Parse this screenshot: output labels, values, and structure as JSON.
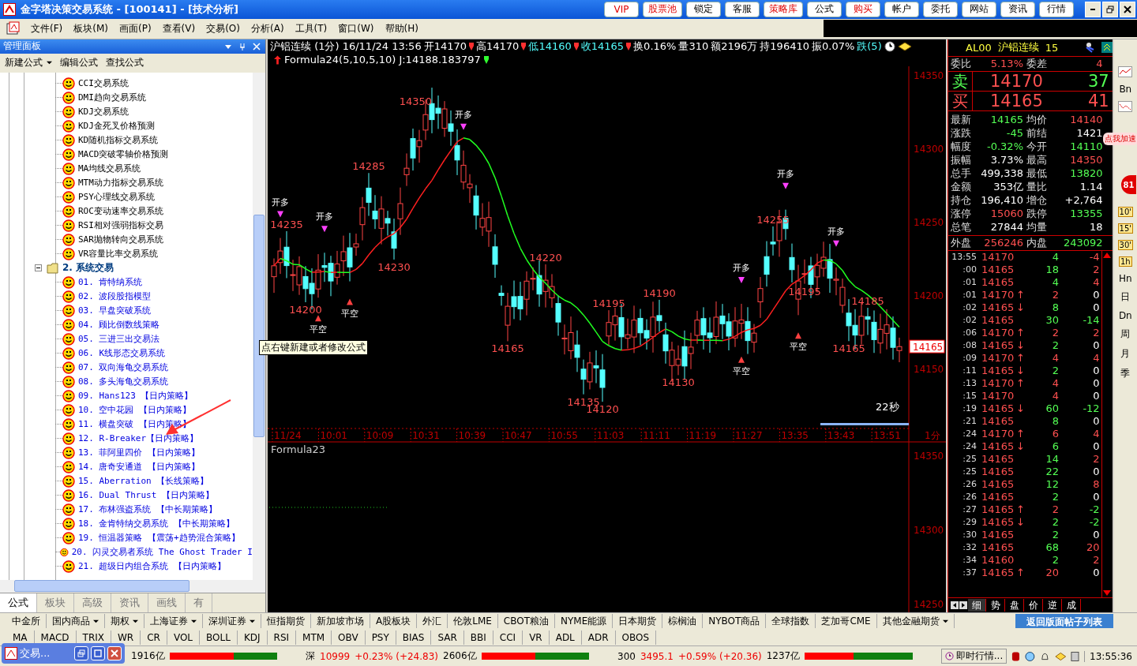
{
  "window": {
    "title": "金字塔决策交易系统 - [100141] - [技术分析]"
  },
  "title_buttons": [
    {
      "label": "VIP",
      "highlighted": true
    },
    {
      "label": "股票池",
      "highlighted": true
    },
    {
      "label": "锁定",
      "highlighted": false
    },
    {
      "label": "客服",
      "highlighted": false
    },
    {
      "label": "策略库",
      "highlighted": true
    },
    {
      "label": "公式",
      "highlighted": false
    },
    {
      "label": "购买",
      "highlighted": true
    },
    {
      "label": "帐户",
      "highlighted": false
    },
    {
      "label": "委托",
      "highlighted": false
    },
    {
      "label": "网站",
      "highlighted": false
    },
    {
      "label": "资讯",
      "highlighted": false
    },
    {
      "label": "行情",
      "highlighted": false
    }
  ],
  "menu": [
    "文件(F)",
    "板块(M)",
    "画面(P)",
    "查看(V)",
    "交易(O)",
    "分析(A)",
    "工具(T)",
    "窗口(W)",
    "帮助(H)"
  ],
  "panel": {
    "title": "管理面板",
    "toolbar": [
      {
        "label": "新建公式",
        "dropdown": true
      },
      {
        "label": "编辑公式",
        "dropdown": false
      },
      {
        "label": "查找公式",
        "dropdown": false
      }
    ],
    "tree": [
      {
        "label": "CCI交易系统",
        "kind": "indicator"
      },
      {
        "label": "DMI趋向交易系统",
        "kind": "indicator"
      },
      {
        "label": "KDJ交易系统",
        "kind": "indicator"
      },
      {
        "label": "KDJ金死叉价格预测",
        "kind": "indicator"
      },
      {
        "label": "KD随机指标交易系统",
        "kind": "indicator"
      },
      {
        "label": "MACD突破零轴价格预测",
        "kind": "indicator"
      },
      {
        "label": "MA均线交易系统",
        "kind": "indicator"
      },
      {
        "label": "MTM动力指标交易系统",
        "kind": "indicator"
      },
      {
        "label": "PSY心理线交易系统",
        "kind": "indicator"
      },
      {
        "label": "ROC变动速率交易系统",
        "kind": "indicator"
      },
      {
        "label": "RSI相对强弱指标交易",
        "kind": "indicator"
      },
      {
        "label": "SAR抛物转向交易系统",
        "kind": "indicator"
      },
      {
        "label": "VR容量比率交易系统",
        "kind": "indicator"
      },
      {
        "label": "2. 系统交易",
        "kind": "folder",
        "expanded": true,
        "children": [
          {
            "label": "01. 肯特纳系统",
            "kind": "strategy"
          },
          {
            "label": "02. 波段股指模型",
            "kind": "strategy"
          },
          {
            "label": "03. 早盘突破系统",
            "kind": "strategy"
          },
          {
            "label": "04. 顾比倒数线策略",
            "kind": "strategy"
          },
          {
            "label": "05. 三进三出交易法",
            "kind": "strategy"
          },
          {
            "label": "06. K线形态交易系统",
            "kind": "strategy"
          },
          {
            "label": "07. 双向海龟交易系统",
            "kind": "strategy"
          },
          {
            "label": "08. 多头海龟交易系统",
            "kind": "strategy"
          },
          {
            "label": "09. Hans123 【日内策略】",
            "kind": "strategy"
          },
          {
            "label": "10. 空中花园 【日内策略】",
            "kind": "strategy"
          },
          {
            "label": "11. 横盘突破 【日内策略】",
            "kind": "strategy"
          },
          {
            "label": "12. R-Breaker【日内策略】",
            "kind": "strategy"
          },
          {
            "label": "13. 菲阿里四价 【日内策略】",
            "kind": "strategy"
          },
          {
            "label": "14. 唐奇安通道 【日内策略】",
            "kind": "strategy"
          },
          {
            "label": "15. Aberration 【长线策略】",
            "kind": "strategy"
          },
          {
            "label": "16. Dual Thrust 【日内策略】",
            "kind": "strategy"
          },
          {
            "label": "17. 布林强盗系统 【中长期策略】",
            "kind": "strategy"
          },
          {
            "label": "18. 金肯特纳交易系统 【中长期策略】",
            "kind": "strategy"
          },
          {
            "label": "19. 恒温器策略 【震荡+趋势混合策略】",
            "kind": "strategy"
          },
          {
            "label": "20. 闪灵交易者系统 The Ghost Trader I",
            "kind": "strategy"
          },
          {
            "label": "21. 超级日内组合系统 【日内策略】",
            "kind": "strategy"
          }
        ]
      }
    ],
    "tabs": [
      {
        "label": "公式",
        "selected": true
      },
      {
        "label": "板块",
        "selected": false
      },
      {
        "label": "高级",
        "selected": false
      },
      {
        "label": "资讯",
        "selected": false
      },
      {
        "label": "画线",
        "selected": false
      },
      {
        "label": "有",
        "selected": false
      }
    ],
    "tooltip": "点右键新建或者修改公式"
  },
  "chart": {
    "symbol": "沪铝连续 (1分) 16/11/24 13:56",
    "header_items": [
      {
        "text": "开14170",
        "color": "#ffffff",
        "marker": true
      },
      {
        "text": "高14170",
        "color": "#ffffff",
        "marker": true
      },
      {
        "text": "低14160",
        "color": "#54ffff",
        "marker": true
      },
      {
        "text": "收14165",
        "color": "#54ffff",
        "marker": true
      },
      {
        "text": "换0.16%",
        "color": "#ffffff",
        "marker": false
      },
      {
        "text": "量310",
        "color": "#ffffff",
        "marker": false
      },
      {
        "text": "额2196万",
        "color": "#ffffff",
        "marker": false
      },
      {
        "text": "持196410",
        "color": "#ffffff",
        "marker": false
      },
      {
        "text": "振0.07%",
        "color": "#ffffff",
        "marker": false
      },
      {
        "text": "跌(5)",
        "color": "#54ffff",
        "marker": false
      }
    ],
    "formula": "Formula24(5,10,5,10) J:14188.183797",
    "price_ticks": [
      "14350",
      "14300",
      "14250",
      "14200",
      "14150"
    ],
    "current_price": "14165",
    "time_labels": [
      "11/24",
      "10:01",
      "10:09",
      "10:31",
      "10:39",
      "10:47",
      "10:55",
      "11:03",
      "11:11",
      "11:19",
      "11:27",
      "13:35",
      "13:43",
      "13:51"
    ],
    "period": "1分",
    "countdown": "22秒",
    "annotations": [
      "14350",
      "14285",
      "14235",
      "14230",
      "14200",
      "14220",
      "14195",
      "14190",
      "14165",
      "14135",
      "14120",
      "14130",
      "14255",
      "14195",
      "14185",
      "14165"
    ],
    "signals": [
      {
        "label": "开多",
        "kind": "open"
      },
      {
        "label": "开多",
        "kind": "open"
      },
      {
        "label": "平空",
        "kind": "close"
      },
      {
        "label": "平空",
        "kind": "close"
      },
      {
        "label": "开多",
        "kind": "open"
      },
      {
        "label": "开多",
        "kind": "open"
      },
      {
        "label": "平空",
        "kind": "close"
      },
      {
        "label": "开多",
        "kind": "open"
      },
      {
        "label": "平空",
        "kind": "close"
      },
      {
        "label": "开多",
        "kind": "open"
      }
    ],
    "lower_pane": {
      "title": "Formula23",
      "price_ticks": [
        "14350",
        "14300",
        "14250"
      ]
    }
  },
  "quote": {
    "code": "AL00",
    "name": "沪铝连续",
    "count": "15",
    "ratio": {
      "label": "委比",
      "value": "5.13%",
      "diff_label": "委差",
      "diff": "4"
    },
    "ask": {
      "label": "卖",
      "price": "14170",
      "volume": {
        "text": "37",
        "color": "#54ff54"
      }
    },
    "bid": {
      "label": "买",
      "price": "14165",
      "volume": {
        "text": "41",
        "color": "#ff5050"
      }
    },
    "stats": [
      {
        "label": "最新",
        "value": "14165",
        "color": "#54ff54"
      },
      {
        "label": "均价",
        "value": "14140",
        "color": "#ff5050"
      },
      {
        "label": "涨跌",
        "value": "-45",
        "color": "#54ff54"
      },
      {
        "label": "前结",
        "value": "1421",
        "color": "#ffffff"
      },
      {
        "label": "幅度",
        "value": "-0.32%",
        "color": "#54ff54"
      },
      {
        "label": "今开",
        "value": "14110",
        "color": "#54ff54"
      },
      {
        "label": "振幅",
        "value": "3.73%",
        "color": "#ffffff"
      },
      {
        "label": "最高",
        "value": "14350",
        "color": "#ff5050"
      },
      {
        "label": "总手",
        "value": "499,338",
        "color": "#ffffff"
      },
      {
        "label": "最低",
        "value": "13820",
        "color": "#54ff54"
      },
      {
        "label": "金额",
        "value": "353亿",
        "color": "#ffffff"
      },
      {
        "label": "量比",
        "value": "1.14",
        "color": "#ffffff"
      },
      {
        "label": "持仓",
        "value": "196,410",
        "color": "#ffffff"
      },
      {
        "label": "增仓",
        "value": "+2,764",
        "color": "#ffffff"
      },
      {
        "label": "涨停",
        "value": "15060",
        "color": "#ff5050"
      },
      {
        "label": "跌停",
        "value": "13355",
        "color": "#54ff54"
      },
      {
        "label": "总笔",
        "value": "27844",
        "color": "#ffffff"
      },
      {
        "label": "均量",
        "value": "18",
        "color": "#ffffff"
      }
    ],
    "outer": {
      "label": "外盘",
      "value": "256246",
      "inner_label": "内盘",
      "inner_value": "243092"
    },
    "ticks": [
      {
        "time": "13:55",
        "price": "14170",
        "volume": {
          "text": "4",
          "color": "#54ff54"
        },
        "change": {
          "text": "-4",
          "color": "#ff5050"
        }
      },
      {
        "time": ":00",
        "price": "14165",
        "volume": {
          "text": "18",
          "color": "#54ff54"
        },
        "change": {
          "text": "2",
          "color": "#ff5050"
        }
      },
      {
        "time": ":01",
        "price": "14165",
        "volume": {
          "text": "4",
          "color": "#54ff54"
        },
        "change": {
          "text": "4",
          "color": "#ff5050"
        }
      },
      {
        "time": ":01",
        "price": "14170",
        "arrow": "↑",
        "volume": {
          "text": "2",
          "color": "#ff5050"
        },
        "change": {
          "text": "0",
          "color": "#ffffff"
        }
      },
      {
        "time": ":02",
        "price": "14165",
        "arrow": "↓",
        "volume": {
          "text": "8",
          "color": "#54ff54"
        },
        "change": {
          "text": "0",
          "color": "#ffffff"
        }
      },
      {
        "time": ":02",
        "price": "14165",
        "volume": {
          "text": "30",
          "color": "#54ff54"
        },
        "change": {
          "text": "-14",
          "color": "#54ff54"
        }
      },
      {
        "time": ":06",
        "price": "14170",
        "arrow": "↑",
        "volume": {
          "text": "2",
          "color": "#ff5050"
        },
        "change": {
          "text": "2",
          "color": "#ff5050"
        }
      },
      {
        "time": ":08",
        "price": "14165",
        "arrow": "↓",
        "volume": {
          "text": "2",
          "color": "#54ff54"
        },
        "change": {
          "text": "0",
          "color": "#ffffff"
        }
      },
      {
        "time": ":09",
        "price": "14170",
        "arrow": "↑",
        "volume": {
          "text": "4",
          "color": "#ff5050"
        },
        "change": {
          "text": "4",
          "color": "#ff5050"
        }
      },
      {
        "time": ":11",
        "price": "14165",
        "arrow": "↓",
        "volume": {
          "text": "2",
          "color": "#54ff54"
        },
        "change": {
          "text": "0",
          "color": "#ffffff"
        }
      },
      {
        "time": ":13",
        "price": "14170",
        "arrow": "↑",
        "volume": {
          "text": "4",
          "color": "#ff5050"
        },
        "change": {
          "text": "0",
          "color": "#ffffff"
        }
      },
      {
        "time": ":15",
        "price": "14170",
        "volume": {
          "text": "4",
          "color": "#ff5050"
        },
        "change": {
          "text": "0",
          "color": "#ffffff"
        }
      },
      {
        "time": ":19",
        "price": "14165",
        "arrow": "↓",
        "volume": {
          "text": "60",
          "color": "#54ff54"
        },
        "change": {
          "text": "-12",
          "color": "#54ff54"
        }
      },
      {
        "time": ":21",
        "price": "14165",
        "volume": {
          "text": "8",
          "color": "#54ff54"
        },
        "change": {
          "text": "0",
          "color": "#ffffff"
        }
      },
      {
        "time": ":24",
        "price": "14170",
        "arrow": "↑",
        "volume": {
          "text": "6",
          "color": "#ff5050"
        },
        "change": {
          "text": "4",
          "color": "#ff5050"
        }
      },
      {
        "time": ":24",
        "price": "14165",
        "arrow": "↓",
        "volume": {
          "text": "6",
          "color": "#54ff54"
        },
        "change": {
          "text": "0",
          "color": "#ffffff"
        }
      },
      {
        "time": ":25",
        "price": "14165",
        "volume": {
          "text": "14",
          "color": "#54ff54"
        },
        "change": {
          "text": "2",
          "color": "#ff5050"
        }
      },
      {
        "time": ":25",
        "price": "14165",
        "volume": {
          "text": "22",
          "color": "#54ff54"
        },
        "change": {
          "text": "0",
          "color": "#ffffff"
        }
      },
      {
        "time": ":26",
        "price": "14165",
        "volume": {
          "text": "12",
          "color": "#54ff54"
        },
        "change": {
          "text": "8",
          "color": "#ff5050"
        }
      },
      {
        "time": ":26",
        "price": "14165",
        "volume": {
          "text": "2",
          "color": "#54ff54"
        },
        "change": {
          "text": "0",
          "color": "#ffffff"
        }
      },
      {
        "time": ":27",
        "price": "14165",
        "arrow": "↑",
        "volume": {
          "text": "2",
          "color": "#ff5050"
        },
        "change": {
          "text": "-2",
          "color": "#54ff54"
        }
      },
      {
        "time": ":29",
        "price": "14165",
        "arrow": "↓",
        "volume": {
          "text": "2",
          "color": "#54ff54"
        },
        "change": {
          "text": "-2",
          "color": "#54ff54"
        }
      },
      {
        "time": ":30",
        "price": "14165",
        "volume": {
          "text": "2",
          "color": "#54ff54"
        },
        "change": {
          "text": "0",
          "color": "#ffffff"
        }
      },
      {
        "time": ":32",
        "price": "14165",
        "volume": {
          "text": "68",
          "color": "#54ff54"
        },
        "change": {
          "text": "20",
          "color": "#ff5050"
        }
      },
      {
        "time": ":34",
        "price": "14160",
        "volume": {
          "text": "2",
          "color": "#54ff54"
        },
        "change": {
          "text": "2",
          "color": "#ff5050"
        }
      },
      {
        "time": ":37",
        "price": "14165",
        "arrow": "↑",
        "volume": {
          "text": "20",
          "color": "#ff5050"
        },
        "change": {
          "text": "0",
          "color": "#ffffff"
        }
      }
    ],
    "tabs": [
      {
        "label": "细",
        "selected": true
      },
      {
        "label": "势",
        "selected": false
      },
      {
        "label": "盘",
        "selected": false
      },
      {
        "label": "价",
        "selected": false
      },
      {
        "label": "逆",
        "selected": false
      },
      {
        "label": "成",
        "selected": false
      }
    ]
  },
  "side_toolbar": [
    "Bn",
    "10'",
    "15'",
    "30'",
    "1h",
    "Hn",
    "日",
    "Dn",
    "周",
    "月",
    "季"
  ],
  "overlay": {
    "badge": "点我加速",
    "counter": "81"
  },
  "market_tabs": [
    {
      "label": "中金所",
      "dropdown": false
    },
    {
      "label": "国内商品",
      "dropdown": true
    },
    {
      "label": "期权",
      "dropdown": true
    },
    {
      "label": "上海证券",
      "dropdown": true
    },
    {
      "label": "深圳证券",
      "dropdown": true
    },
    {
      "label": "恒指期货",
      "dropdown": false
    },
    {
      "label": "新加坡市场",
      "dropdown": false
    },
    {
      "label": "A股板块",
      "dropdown": false
    },
    {
      "label": "外汇",
      "dropdown": false
    },
    {
      "label": "伦敦LME",
      "dropdown": false
    },
    {
      "label": "CBOT粮油",
      "dropdown": false
    },
    {
      "label": "NYME能源",
      "dropdown": false
    },
    {
      "label": "日本期货",
      "dropdown": false
    },
    {
      "label": "棕榈油",
      "dropdown": false
    },
    {
      "label": "NYBOT商品",
      "dropdown": false
    },
    {
      "label": "全球指数",
      "dropdown": false
    },
    {
      "label": "芝加哥CME",
      "dropdown": false
    },
    {
      "label": "其他金融期货",
      "dropdown": true
    }
  ],
  "return_link": "返回版面帖子列表",
  "indicators": [
    "MA",
    "MACD",
    "TRIX",
    "WR",
    "CR",
    "VOL",
    "BOLL",
    "KDJ",
    "RSI",
    "MTM",
    "OBV",
    "PSY",
    "BIAS",
    "SAR",
    "BBI",
    "CCI",
    "VR",
    "ADL",
    "ADR",
    "OBOS"
  ],
  "status_bar": {
    "indices": [
      {
        "amount": "1916亿",
        "level": 0.6
      },
      {
        "market": "深",
        "value": "10999",
        "change": "+0.23% (+24.83)",
        "amount": "2606亿",
        "level": 0.5
      },
      {
        "market": "300",
        "value": "3495.1",
        "change": "+0.59% (+20.36)",
        "amount": "1237亿",
        "level": 0.45
      }
    ],
    "live": "即时行情...",
    "time": "13:55:36"
  },
  "taskbar_window": {
    "title": "交易..."
  }
}
